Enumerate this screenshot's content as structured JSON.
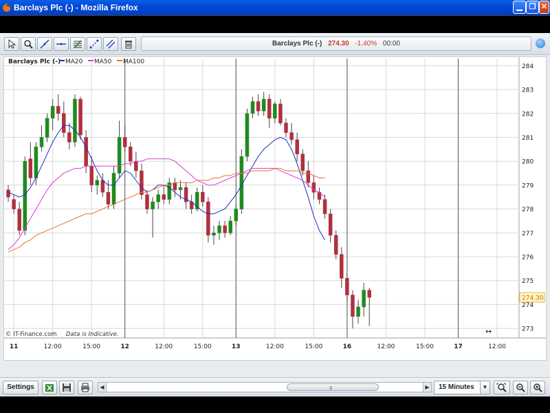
{
  "window": {
    "title": "Barclays Plc (-) - Mozilla Firefox"
  },
  "toolbar": {
    "tools": [
      "pointer-icon",
      "zoom-icon",
      "trendline-icon",
      "horizontal-line-icon",
      "fibonacci-icon",
      "ruler-icon",
      "parallel-lines-icon",
      "trash-icon"
    ],
    "instrument_name": "Barclays Plc (-)",
    "last_price": "274.30",
    "change_pct": "-1.40%",
    "time": "00:00"
  },
  "chart": {
    "legend_title": "Barclays Plc (-)",
    "watermark": "© IT-Finance.com",
    "disclaimer": "Data is Indicative.",
    "last_price_tag": "274.30"
  },
  "bottom": {
    "settings_label": "Settings",
    "interval_label": "15 Minutes",
    "scroll_grip": "III"
  },
  "colors": {
    "up": "#1f8a1f",
    "down": "#b03040",
    "ma20": "#1a2dbf",
    "ma50": "#d83bd8",
    "ma100": "#e0762a",
    "grid": "#d8d8d8",
    "sep": "#555555"
  },
  "chart_data": {
    "type": "candlestick",
    "title": "Barclays Plc (-)",
    "ylim": [
      272.6,
      284.3
    ],
    "yticks": [
      273,
      274,
      275,
      276,
      277,
      278,
      279,
      280,
      281,
      282,
      283,
      284
    ],
    "xlim": [
      0,
      63
    ],
    "xticks": [
      {
        "label": "11",
        "x": 1,
        "day": true
      },
      {
        "label": "12:00",
        "x": 8
      },
      {
        "label": "15:00",
        "x": 15
      },
      {
        "label": "12",
        "x": 21,
        "day": true
      },
      {
        "label": "12:00",
        "x": 28
      },
      {
        "label": "15:00",
        "x": 35
      },
      {
        "label": "13",
        "x": 41,
        "day": true
      },
      {
        "label": "12:00",
        "x": 48
      },
      {
        "label": "15:00",
        "x": 55
      },
      {
        "label": "16",
        "x": 61,
        "day": true
      },
      {
        "label": "12:00",
        "x": 68
      },
      {
        "label": "15:00",
        "x": 75
      },
      {
        "label": "17",
        "x": 81,
        "day": true
      },
      {
        "label": "12:00",
        "x": 88
      }
    ],
    "day_separators": [
      21,
      41,
      61,
      81
    ],
    "series": [
      {
        "name": "MA20",
        "color": "#1a2dbf",
        "x_start": 0,
        "values": [
          278.7,
          278.6,
          278.5,
          278.6,
          278.9,
          279.3,
          279.8,
          280.3,
          280.8,
          281.2,
          281.5,
          281.5,
          281.3,
          281.0,
          280.6,
          280.1,
          279.6,
          279.2,
          279.0,
          279.0,
          279.3,
          279.6,
          279.5,
          279.2,
          278.9,
          278.7,
          278.8,
          279.0,
          279.0,
          278.9,
          278.7,
          278.5,
          278.4,
          278.3,
          278.1,
          277.9,
          277.8,
          277.8,
          277.9,
          278.0,
          278.3,
          278.6,
          279.0,
          279.4,
          279.8,
          280.2,
          280.5,
          280.7,
          280.9,
          281.0,
          280.9,
          280.5,
          279.9,
          279.2,
          278.5,
          277.7,
          277.1,
          276.7
        ]
      },
      {
        "name": "MA50",
        "color": "#d83bd8",
        "x_start": 0,
        "values": [
          276.3,
          276.5,
          276.8,
          277.2,
          277.6,
          278.0,
          278.4,
          278.8,
          279.1,
          279.3,
          279.5,
          279.6,
          279.7,
          279.7,
          279.8,
          279.8,
          279.8,
          279.8,
          279.8,
          279.8,
          279.8,
          279.9,
          279.9,
          280.0,
          280.0,
          280.1,
          280.1,
          280.1,
          280.1,
          280.1,
          280.0,
          279.8,
          279.6,
          279.4,
          279.2,
          279.1,
          279.0,
          279.0,
          279.1,
          279.2,
          279.3,
          279.4,
          279.5,
          279.6,
          279.7,
          279.7,
          279.7,
          279.7,
          279.7,
          279.6,
          279.5,
          279.4,
          279.3,
          279.2,
          279.0,
          278.8,
          278.7,
          278.5
        ]
      },
      {
        "name": "MA100",
        "color": "#e0762a",
        "x_start": 0,
        "values": [
          276.2,
          276.3,
          276.4,
          276.6,
          276.7,
          276.9,
          277.0,
          277.1,
          277.2,
          277.3,
          277.4,
          277.5,
          277.6,
          277.7,
          277.8,
          277.8,
          277.9,
          278.0,
          278.1,
          278.2,
          278.3,
          278.4,
          278.5,
          278.6,
          278.7,
          278.7,
          278.8,
          278.9,
          279.0,
          279.0,
          279.1,
          279.1,
          279.1,
          279.1,
          279.2,
          279.2,
          279.2,
          279.3,
          279.3,
          279.4,
          279.4,
          279.5,
          279.5,
          279.5,
          279.6,
          279.6,
          279.6,
          279.6,
          279.7,
          279.7,
          279.6,
          279.6,
          279.6,
          279.5,
          279.5,
          279.4,
          279.3,
          279.3
        ]
      }
    ],
    "candles": [
      {
        "o": 278.8,
        "h": 279.0,
        "l": 278.3,
        "c": 278.5
      },
      {
        "o": 278.4,
        "h": 278.6,
        "l": 277.8,
        "c": 278.0
      },
      {
        "o": 278.0,
        "h": 278.3,
        "l": 276.9,
        "c": 277.1
      },
      {
        "o": 277.1,
        "h": 280.2,
        "l": 276.9,
        "c": 280.0
      },
      {
        "o": 280.1,
        "h": 280.8,
        "l": 279.0,
        "c": 279.3
      },
      {
        "o": 279.3,
        "h": 280.8,
        "l": 279.0,
        "c": 280.6
      },
      {
        "o": 280.6,
        "h": 281.5,
        "l": 280.4,
        "c": 281.0
      },
      {
        "o": 281.0,
        "h": 282.0,
        "l": 280.8,
        "c": 281.8
      },
      {
        "o": 281.8,
        "h": 282.6,
        "l": 281.3,
        "c": 282.3
      },
      {
        "o": 282.3,
        "h": 282.8,
        "l": 281.7,
        "c": 282.0
      },
      {
        "o": 282.0,
        "h": 282.5,
        "l": 281.0,
        "c": 281.2
      },
      {
        "o": 281.2,
        "h": 281.6,
        "l": 280.5,
        "c": 280.8
      },
      {
        "o": 280.8,
        "h": 282.8,
        "l": 280.6,
        "c": 282.6
      },
      {
        "o": 282.6,
        "h": 282.7,
        "l": 280.9,
        "c": 281.1
      },
      {
        "o": 281.0,
        "h": 281.3,
        "l": 279.5,
        "c": 279.8
      },
      {
        "o": 279.8,
        "h": 280.2,
        "l": 278.7,
        "c": 279.0
      },
      {
        "o": 279.0,
        "h": 279.4,
        "l": 278.6,
        "c": 279.2
      },
      {
        "o": 279.2,
        "h": 279.5,
        "l": 278.5,
        "c": 278.7
      },
      {
        "o": 278.7,
        "h": 279.2,
        "l": 278.0,
        "c": 278.2
      },
      {
        "o": 278.2,
        "h": 279.8,
        "l": 278.0,
        "c": 279.5
      },
      {
        "o": 279.5,
        "h": 281.7,
        "l": 279.3,
        "c": 281.0
      },
      {
        "o": 281.0,
        "h": 281.5,
        "l": 280.4,
        "c": 280.6
      },
      {
        "o": 280.6,
        "h": 280.8,
        "l": 279.8,
        "c": 280.0
      },
      {
        "o": 280.0,
        "h": 280.4,
        "l": 279.3,
        "c": 279.6
      },
      {
        "o": 279.6,
        "h": 279.9,
        "l": 278.4,
        "c": 278.6
      },
      {
        "o": 278.6,
        "h": 278.8,
        "l": 277.8,
        "c": 278.0
      },
      {
        "o": 278.0,
        "h": 278.5,
        "l": 276.8,
        "c": 278.3
      },
      {
        "o": 278.3,
        "h": 278.8,
        "l": 278.0,
        "c": 278.6
      },
      {
        "o": 278.6,
        "h": 279.0,
        "l": 278.2,
        "c": 278.4
      },
      {
        "o": 278.4,
        "h": 279.3,
        "l": 278.2,
        "c": 279.1
      },
      {
        "o": 279.1,
        "h": 279.3,
        "l": 278.5,
        "c": 278.8
      },
      {
        "o": 278.8,
        "h": 279.2,
        "l": 278.4,
        "c": 278.9
      },
      {
        "o": 278.9,
        "h": 279.1,
        "l": 278.0,
        "c": 278.3
      },
      {
        "o": 278.3,
        "h": 278.6,
        "l": 277.8,
        "c": 278.0
      },
      {
        "o": 278.0,
        "h": 278.9,
        "l": 277.9,
        "c": 278.7
      },
      {
        "o": 278.7,
        "h": 279.0,
        "l": 278.1,
        "c": 278.3
      },
      {
        "o": 278.3,
        "h": 278.5,
        "l": 276.6,
        "c": 276.9
      },
      {
        "o": 276.9,
        "h": 277.3,
        "l": 276.5,
        "c": 277.0
      },
      {
        "o": 277.0,
        "h": 277.5,
        "l": 276.7,
        "c": 277.3
      },
      {
        "o": 277.3,
        "h": 277.5,
        "l": 276.8,
        "c": 277.0
      },
      {
        "o": 277.0,
        "h": 277.7,
        "l": 276.9,
        "c": 277.5
      },
      {
        "o": 277.5,
        "h": 278.2,
        "l": 277.3,
        "c": 278.0
      },
      {
        "o": 278.0,
        "h": 280.5,
        "l": 277.8,
        "c": 280.2
      },
      {
        "o": 280.2,
        "h": 282.2,
        "l": 280.0,
        "c": 282.0
      },
      {
        "o": 282.0,
        "h": 282.7,
        "l": 281.8,
        "c": 282.5
      },
      {
        "o": 282.5,
        "h": 282.8,
        "l": 281.9,
        "c": 282.1
      },
      {
        "o": 282.1,
        "h": 282.9,
        "l": 281.9,
        "c": 282.6
      },
      {
        "o": 282.6,
        "h": 282.8,
        "l": 281.4,
        "c": 281.8
      },
      {
        "o": 281.8,
        "h": 282.5,
        "l": 281.6,
        "c": 282.4
      },
      {
        "o": 282.4,
        "h": 282.6,
        "l": 281.5,
        "c": 281.6
      },
      {
        "o": 281.6,
        "h": 281.8,
        "l": 281.0,
        "c": 281.2
      },
      {
        "o": 281.2,
        "h": 281.6,
        "l": 280.7,
        "c": 280.9
      },
      {
        "o": 280.9,
        "h": 281.2,
        "l": 280.0,
        "c": 280.3
      },
      {
        "o": 280.3,
        "h": 280.5,
        "l": 279.4,
        "c": 279.6
      },
      {
        "o": 279.6,
        "h": 280.0,
        "l": 278.9,
        "c": 279.1
      },
      {
        "o": 279.1,
        "h": 279.4,
        "l": 278.4,
        "c": 278.7
      },
      {
        "o": 278.7,
        "h": 278.9,
        "l": 278.2,
        "c": 278.4
      },
      {
        "o": 278.4,
        "h": 278.6,
        "l": 277.6,
        "c": 277.8
      },
      {
        "o": 277.8,
        "h": 278.0,
        "l": 276.6,
        "c": 276.9
      },
      {
        "o": 276.9,
        "h": 277.1,
        "l": 275.9,
        "c": 276.1
      },
      {
        "o": 276.1,
        "h": 276.4,
        "l": 274.7,
        "c": 275.1
      },
      {
        "o": 275.1,
        "h": 275.3,
        "l": 274.1,
        "c": 274.4
      },
      {
        "o": 274.4,
        "h": 274.6,
        "l": 273.0,
        "c": 273.5
      },
      {
        "o": 273.5,
        "h": 274.2,
        "l": 273.2,
        "c": 273.9
      },
      {
        "o": 273.9,
        "h": 274.9,
        "l": 273.5,
        "c": 274.6
      },
      {
        "o": 274.6,
        "h": 274.7,
        "l": 273.1,
        "c": 274.3
      }
    ]
  }
}
